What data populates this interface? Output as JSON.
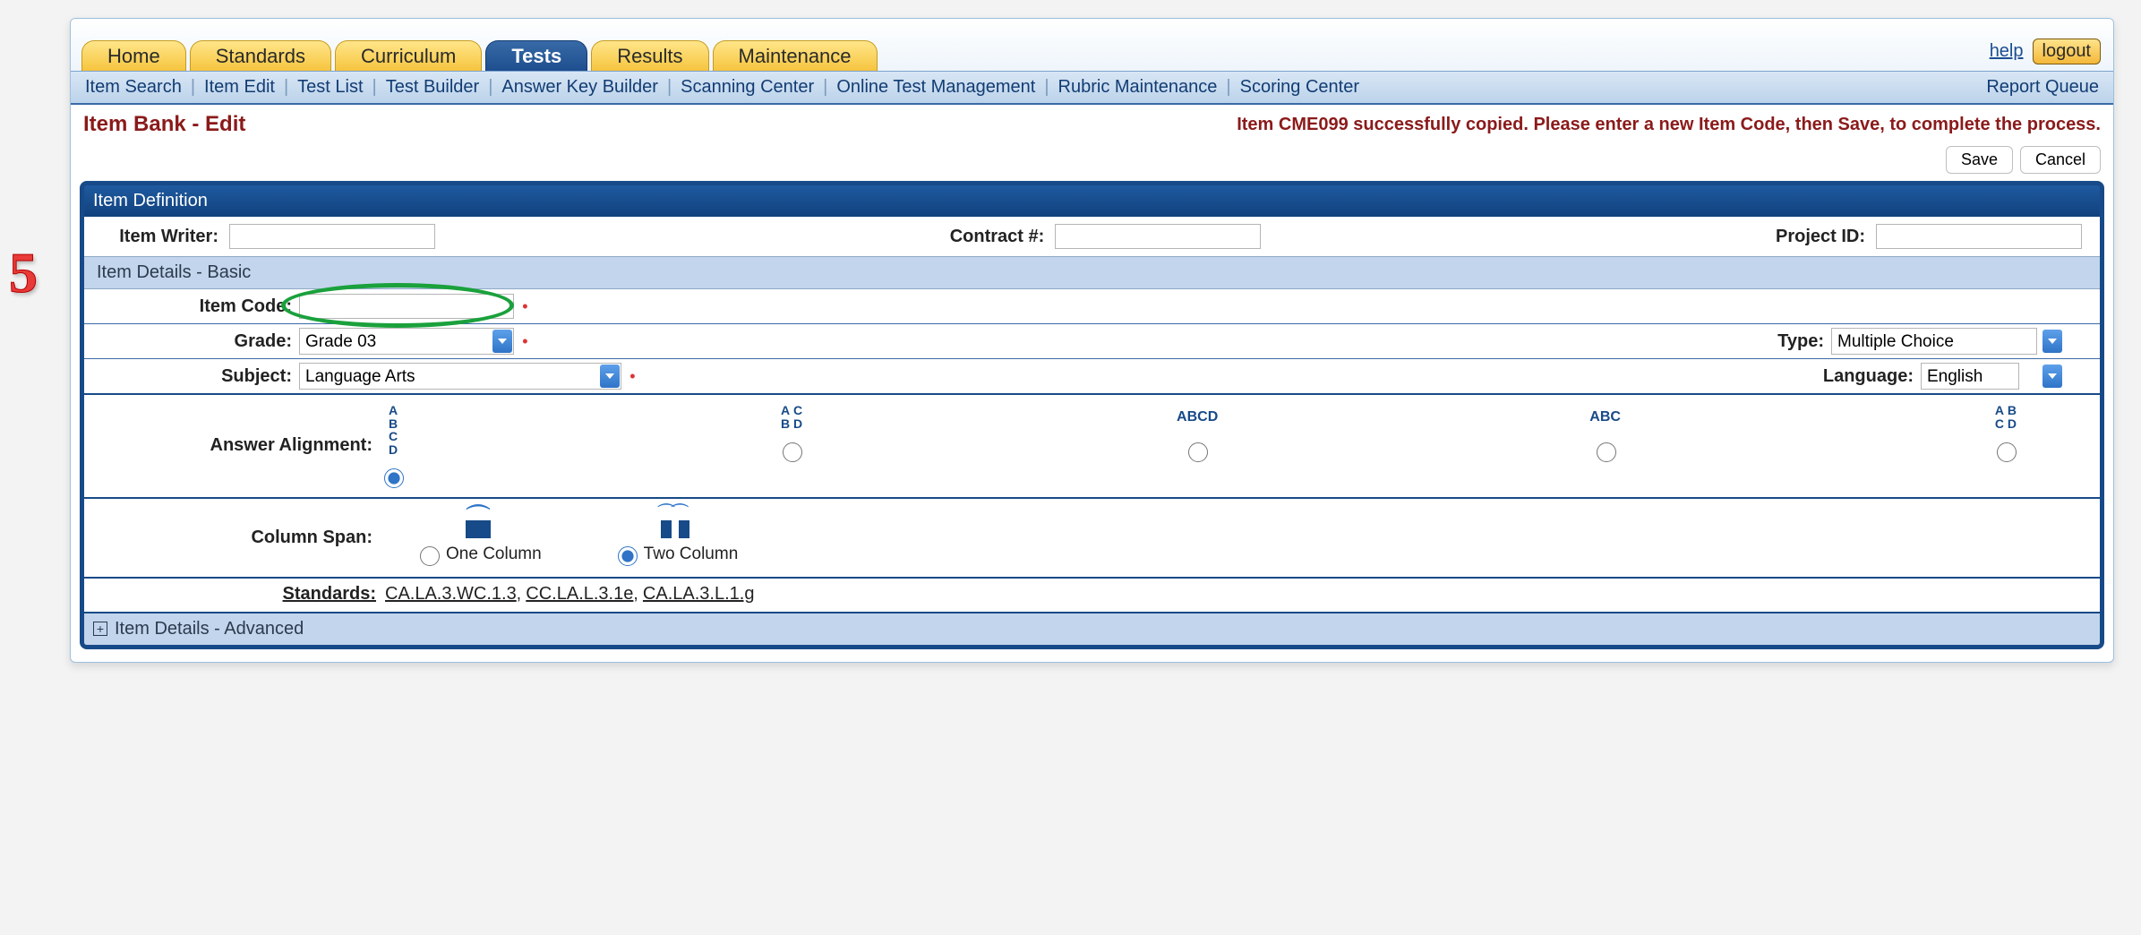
{
  "step_number": "5",
  "toplinks": {
    "help": "help",
    "logout": "logout"
  },
  "tabs": [
    {
      "label": "Home"
    },
    {
      "label": "Standards"
    },
    {
      "label": "Curriculum"
    },
    {
      "label": "Tests",
      "active": true
    },
    {
      "label": "Results"
    },
    {
      "label": "Maintenance"
    }
  ],
  "submenu": [
    "Item Search",
    "Item Edit",
    "Test List",
    "Test Builder",
    "Answer Key Builder",
    "Scanning Center",
    "Online Test Management",
    "Rubric Maintenance",
    "Scoring Center"
  ],
  "submenu_right": "Report Queue",
  "page_title": "Item Bank - Edit",
  "status_message": "Item CME099 successfully copied. Please enter a new Item Code, then Save, to complete the process.",
  "buttons": {
    "save": "Save",
    "cancel": "Cancel"
  },
  "panel": {
    "title": "Item Definition",
    "writer_label": "Item Writer:",
    "writer_value": "",
    "contract_label": "Contract #:",
    "contract_value": "",
    "project_label": "Project ID:",
    "project_value": ""
  },
  "basic": {
    "section_title": "Item Details - Basic",
    "item_code_label": "Item Code:",
    "item_code_value": "",
    "grade_label": "Grade:",
    "grade_value": "Grade 03",
    "type_label": "Type:",
    "type_value": "Multiple Choice",
    "subject_label": "Subject:",
    "subject_value": "Language Arts",
    "language_label": "Language:",
    "language_value": "English",
    "align_label": "Answer Alignment:",
    "align_options": [
      "vertical-abcd",
      "grid-acbd",
      "row-abcd",
      "row-abc",
      "grid-abcd"
    ],
    "colspan_label": "Column Span:",
    "one_col": "One Column",
    "two_col": "Two Column",
    "standards_label": "Standards:",
    "standards": [
      "CA.LA.3.WC.1.3",
      "CC.LA.L.3.1e",
      "CA.LA.3.L.1.g"
    ]
  },
  "advanced_title": "Item Details - Advanced"
}
